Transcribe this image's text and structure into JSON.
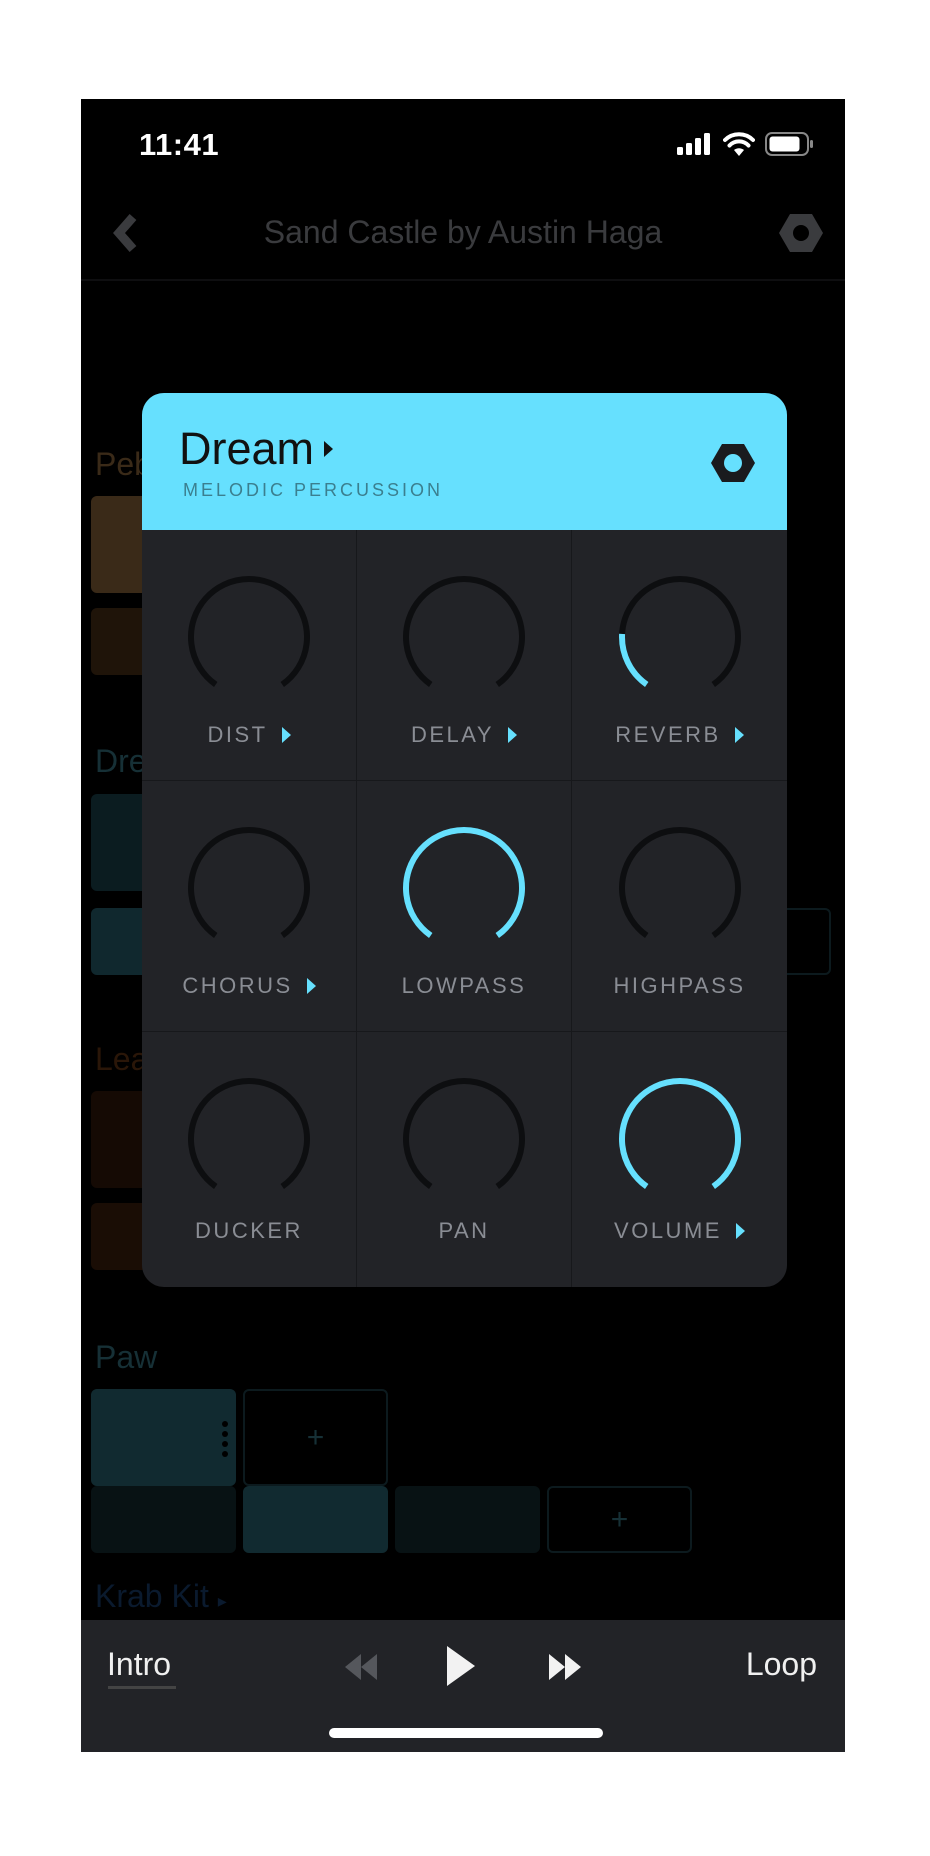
{
  "status_bar": {
    "time": "11:41",
    "icons": [
      "signal-icon",
      "wifi-icon",
      "battery-icon"
    ]
  },
  "nav": {
    "title": "Sand Castle by Austin Haga",
    "back_icon": "chevron-left-icon",
    "settings_icon": "hex-nut-settings-icon"
  },
  "background_sections": [
    {
      "label": "Pebble",
      "color": "#3a2a18"
    },
    {
      "label": "Dream",
      "color": "#10282e"
    },
    {
      "label": "Lead",
      "color": "#2a1608"
    },
    {
      "label": "Paw",
      "color": "#112a30"
    },
    {
      "label": "Krab Kit",
      "color": "#0a1a2e"
    }
  ],
  "add_tile_label": "+",
  "modal": {
    "title": "Dream",
    "subtitle": "MELODIC PERCUSSION",
    "accent": "#66e0fe",
    "knobs": [
      {
        "label": "DIST",
        "value": 0,
        "has_submenu": true
      },
      {
        "label": "DELAY",
        "value": 0,
        "has_submenu": true
      },
      {
        "label": "REVERB",
        "value": 0.2,
        "has_submenu": true
      },
      {
        "label": "CHORUS",
        "value": 0,
        "has_submenu": true
      },
      {
        "label": "LOWPASS",
        "value": 1.0,
        "has_submenu": false
      },
      {
        "label": "HIGHPASS",
        "value": 0,
        "has_submenu": false
      },
      {
        "label": "DUCKER",
        "value": 0,
        "has_submenu": false
      },
      {
        "label": "PAN",
        "value": 0,
        "has_submenu": false
      },
      {
        "label": "VOLUME",
        "value": 1.0,
        "has_submenu": true
      }
    ]
  },
  "transport": {
    "section_label": "Intro",
    "loop_label": "Loop",
    "buttons": [
      "rewind-icon",
      "play-icon",
      "fast-forward-icon"
    ]
  }
}
